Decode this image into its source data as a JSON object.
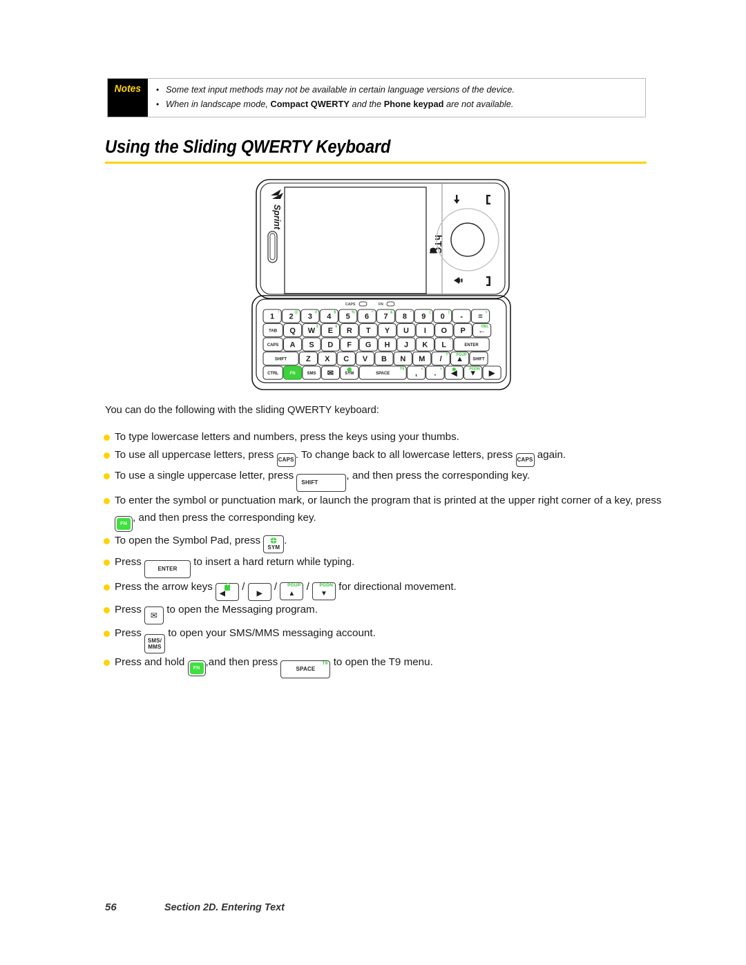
{
  "notes": {
    "label": "Notes",
    "items": [
      {
        "pre": "Some text input methods may not be available in certain language versions of the device.",
        "bold1": "",
        "mid": "",
        "bold2": "",
        "post": ""
      },
      {
        "pre": "When in landscape mode, ",
        "bold1": "Compact QWERTY",
        "mid": " and the ",
        "bold2": "Phone keypad",
        "post": " are not available."
      }
    ],
    "bullet_glyph": "•"
  },
  "heading": {
    "title": "Using the Sliding QWERTY Keyboard",
    "rule_color": "#ffd200"
  },
  "intro": "You can do the following with the sliding QWERTY keyboard:",
  "bullets": [
    {
      "id": "lowercase",
      "parts": [
        {
          "t": "text",
          "v": "To type lowercase letters and numbers, press the keys using your thumbs."
        }
      ]
    },
    {
      "id": "uppercase-all",
      "parts": [
        {
          "t": "text",
          "v": "To use all uppercase letters, press "
        },
        {
          "t": "key",
          "k": "caps",
          "label": "CAPS"
        },
        {
          "t": "text",
          "v": ". To change back to all lowercase letters, press "
        },
        {
          "t": "key",
          "k": "caps",
          "label": "CAPS"
        },
        {
          "t": "text",
          "v": " again."
        }
      ]
    },
    {
      "id": "uppercase-single",
      "parts": [
        {
          "t": "text",
          "v": "To use a single uppercase letter, press "
        },
        {
          "t": "key",
          "k": "shift",
          "label": "SHIFT"
        },
        {
          "t": "text",
          "v": ", and then press the corresponding key."
        }
      ]
    },
    {
      "id": "symbol-fn",
      "parts": [
        {
          "t": "text",
          "v": "To enter the symbol or punctuation mark, or launch the program that is printed at the upper right corner of a key, press "
        },
        {
          "t": "key",
          "k": "fn",
          "label": "FN"
        },
        {
          "t": "text",
          "v": ", and then press the corresponding key."
        }
      ]
    },
    {
      "id": "symbol-pad",
      "parts": [
        {
          "t": "text",
          "v": "To open the Symbol Pad, press "
        },
        {
          "t": "key",
          "k": "sym",
          "label": "SYM"
        },
        {
          "t": "text",
          "v": "."
        }
      ]
    },
    {
      "id": "enter",
      "parts": [
        {
          "t": "text",
          "v": "Press "
        },
        {
          "t": "key",
          "k": "enter",
          "label": "ENTER"
        },
        {
          "t": "text",
          "v": " to insert a hard return while typing."
        }
      ]
    },
    {
      "id": "arrows",
      "parts": [
        {
          "t": "text",
          "v": "Press the arrow keys "
        },
        {
          "t": "key",
          "k": "arrow-left",
          "label": "◀",
          "top": ""
        },
        {
          "t": "text",
          "v": " / "
        },
        {
          "t": "key",
          "k": "arrow-right",
          "label": "▶",
          "top": ""
        },
        {
          "t": "text",
          "v": " / "
        },
        {
          "t": "key",
          "k": "arrow-up",
          "label": "▲",
          "top": "PGUP"
        },
        {
          "t": "text",
          "v": " / "
        },
        {
          "t": "key",
          "k": "arrow-down",
          "label": "▼",
          "top": "PGDN"
        },
        {
          "t": "text",
          "v": " for directional movement."
        }
      ]
    },
    {
      "id": "messaging",
      "parts": [
        {
          "t": "text",
          "v": "Press "
        },
        {
          "t": "key",
          "k": "msg",
          "label": "✉"
        },
        {
          "t": "text",
          "v": " to open the Messaging program."
        }
      ]
    },
    {
      "id": "sms-mms",
      "parts": [
        {
          "t": "text",
          "v": "Press "
        },
        {
          "t": "key",
          "k": "sms",
          "label": "SMS/",
          "label2": "MMS"
        },
        {
          "t": "text",
          "v": " to open your SMS/MMS messaging account."
        }
      ]
    },
    {
      "id": "t9-menu",
      "parts": [
        {
          "t": "text",
          "v": "Press and hold "
        },
        {
          "t": "key",
          "k": "fn",
          "label": "FN"
        },
        {
          "t": "text",
          "v": ",and then press "
        },
        {
          "t": "key",
          "k": "space",
          "label": "SPACE",
          "top": "T9"
        },
        {
          "t": "text",
          "v": " to open the T9 menu."
        }
      ]
    }
  ],
  "phone": {
    "brand_left": "Sprint",
    "brand_right": "hTC",
    "indicators": [
      {
        "label": "CAPS"
      },
      {
        "label": "FN"
      }
    ],
    "keyboard_rows": [
      {
        "row": "numbers",
        "keys": [
          {
            "main": "1",
            "alt": "!"
          },
          {
            "main": "2",
            "alt": "@"
          },
          {
            "main": "3",
            "alt": "#"
          },
          {
            "main": "4",
            "alt": "$"
          },
          {
            "main": "5",
            "alt": "%"
          },
          {
            "main": "6",
            "alt": "^"
          },
          {
            "main": "7",
            "alt": "&"
          },
          {
            "main": "8",
            "alt": "*"
          },
          {
            "main": "9",
            "alt": "("
          },
          {
            "main": "0",
            "alt": ")"
          },
          {
            "main": "-",
            "alt": "_"
          },
          {
            "main": "=",
            "alt": "+"
          }
        ]
      },
      {
        "row": "qwerty",
        "keys": [
          {
            "main": "TAB",
            "alt": "",
            "wide": true
          },
          {
            "main": "Q",
            "alt": ""
          },
          {
            "main": "W",
            "alt": "Σ"
          },
          {
            "main": "E",
            "alt": "€"
          },
          {
            "main": "R",
            "alt": ""
          },
          {
            "main": "T",
            "alt": ""
          },
          {
            "main": "Y",
            "alt": ""
          },
          {
            "main": "U",
            "alt": ""
          },
          {
            "main": "I",
            "alt": ""
          },
          {
            "main": "O",
            "alt": ""
          },
          {
            "main": "P",
            "alt": ""
          },
          {
            "main": "←",
            "alt": "DEL"
          }
        ]
      },
      {
        "row": "asdf",
        "keys": [
          {
            "main": "CAPS",
            "alt": "",
            "wide": true
          },
          {
            "main": "A",
            "alt": ""
          },
          {
            "main": "S",
            "alt": ""
          },
          {
            "main": "D",
            "alt": ""
          },
          {
            "main": "F",
            "alt": ""
          },
          {
            "main": "G",
            "alt": ""
          },
          {
            "main": "H",
            "alt": ""
          },
          {
            "main": "J",
            "alt": ""
          },
          {
            "main": "K",
            "alt": "'"
          },
          {
            "main": "L",
            "alt": "\""
          },
          {
            "main": "ENTER",
            "alt": "",
            "xwide": true
          }
        ]
      },
      {
        "row": "zxcv",
        "keys": [
          {
            "main": "SHIFT",
            "alt": "",
            "xwide": true
          },
          {
            "main": "Z",
            "alt": ""
          },
          {
            "main": "X",
            "alt": ""
          },
          {
            "main": "C",
            "alt": ""
          },
          {
            "main": "V",
            "alt": ""
          },
          {
            "main": "B",
            "alt": ""
          },
          {
            "main": "N",
            "alt": ""
          },
          {
            "main": "M",
            "alt": ""
          },
          {
            "main": "/",
            "alt": "?"
          },
          {
            "main": "▲",
            "alt": "PGUP"
          },
          {
            "main": "SHIFT",
            "alt": ""
          }
        ]
      },
      {
        "row": "bottom",
        "keys": [
          {
            "main": "CTRL",
            "alt": "",
            "wide": true
          },
          {
            "main": "FN",
            "alt": "",
            "green": true
          },
          {
            "main": "SMS",
            "alt": ""
          },
          {
            "main": "✉",
            "alt": ""
          },
          {
            "main": "SYM",
            "alt": "",
            "globe": true
          },
          {
            "main": "SPACE",
            "alt": "T9",
            "xxwide": true
          },
          {
            "main": ",",
            "alt": "<"
          },
          {
            "main": ".",
            "alt": ">"
          },
          {
            "main": "◀",
            "alt": "",
            "lock": true
          },
          {
            "main": "▼",
            "alt": "PGDN"
          },
          {
            "main": "▶",
            "alt": ""
          }
        ]
      }
    ]
  },
  "footer": {
    "page_number": "56",
    "section": "Section 2D. Entering Text"
  },
  "colors": {
    "accent_yellow": "#ffd200",
    "key_green": "#3fd13f",
    "text": "#1a1a1a"
  }
}
